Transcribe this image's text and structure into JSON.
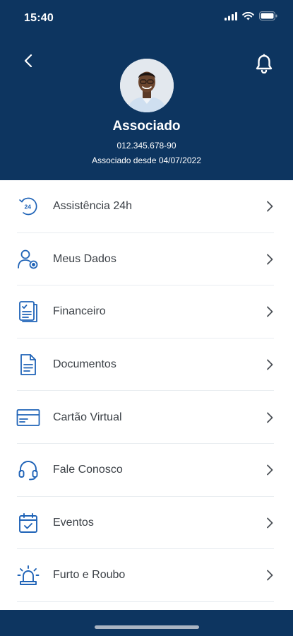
{
  "status_bar": {
    "time": "15:40"
  },
  "profile": {
    "name": "Associado",
    "member_id": "012.345.678-90",
    "member_since": "Associado desde 04/07/2022"
  },
  "menu": {
    "items": [
      {
        "label": "Assistência 24h",
        "icon": "clock-24h-icon"
      },
      {
        "label": "Meus Dados",
        "icon": "user-settings-icon"
      },
      {
        "label": "Financeiro",
        "icon": "financial-document-icon"
      },
      {
        "label": "Documentos",
        "icon": "document-icon"
      },
      {
        "label": "Cartão Virtual",
        "icon": "card-icon"
      },
      {
        "label": "Fale Conosco",
        "icon": "headset-icon"
      },
      {
        "label": "Eventos",
        "icon": "calendar-check-icon"
      },
      {
        "label": "Furto e Roubo",
        "icon": "alarm-siren-icon"
      }
    ]
  },
  "colors": {
    "header_bg": "#0d3560",
    "icon_blue": "#1f63b7",
    "text": "#3a3f45"
  }
}
